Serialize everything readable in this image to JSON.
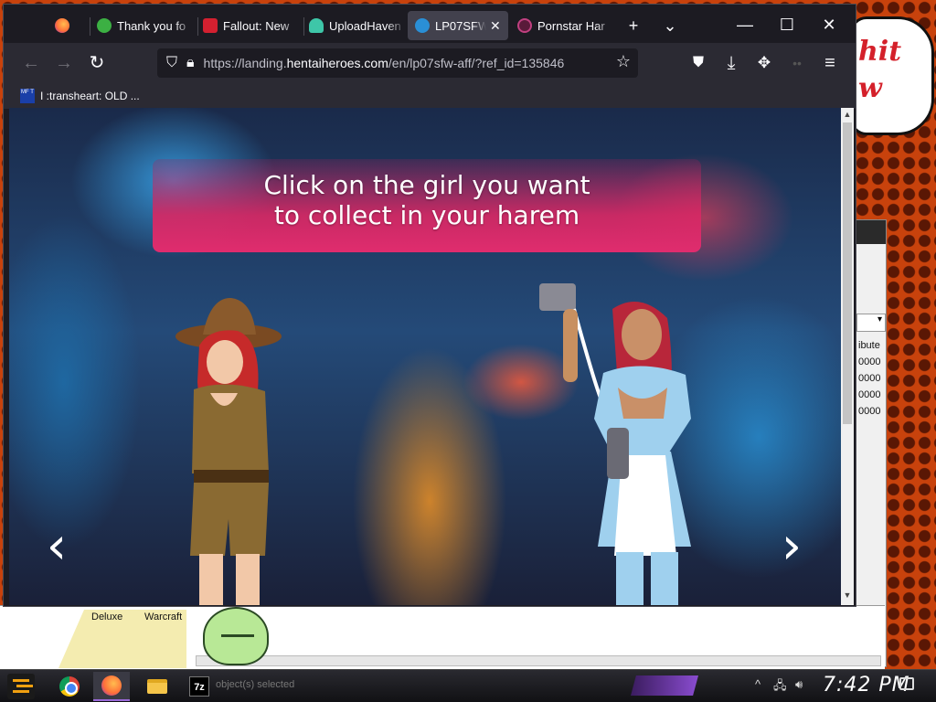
{
  "browser": {
    "tabs": [
      {
        "title": "",
        "icon": "firefox-icon",
        "active": false
      },
      {
        "title": "Thank you fo",
        "icon": "green-site-icon",
        "active": false
      },
      {
        "title": "Fallout: New",
        "icon": "red-site-icon",
        "active": false
      },
      {
        "title": "UploadHaven",
        "icon": "cloud-icon",
        "active": false
      },
      {
        "title": "LP07SFW",
        "icon": "globe-icon",
        "active": true
      },
      {
        "title": "Pornstar Har",
        "icon": "purple-site-icon",
        "active": false
      }
    ],
    "new_tab": "+",
    "tab_list": "⌄",
    "window_controls": {
      "minimize": "—",
      "maximize": "☐",
      "close": "✕"
    },
    "url_prefix": "https://landing.",
    "url_domain": "hentaiheroes.com",
    "url_path": "/en/lp07sfw-aff/?ref_id=135846",
    "bookmark_label": "I :transheart: OLD ...",
    "bookmark_icon_text": "MF T"
  },
  "page": {
    "banner_line1": "Click on the girl you want",
    "banner_line2": "to collect in your harem",
    "prev_arrow": "‹",
    "next_arrow": "›"
  },
  "desktop": {
    "bubble_line1": "hit",
    "bubble_line2": "w",
    "bg_window": {
      "header": "ibute",
      "rows": [
        "0000",
        "0000",
        "0000",
        "0000"
      ]
    },
    "explorer_labels": [
      "Deluxe",
      "Warcraft"
    ],
    "explorer_status": "object(s) selected"
  },
  "taskbar": {
    "sevenzip_label": "7z",
    "clock": "7:42 PM",
    "tray_chevron": "^"
  },
  "colors": {
    "accent_pink": "#e02c6e",
    "browser_dark": "#1c1b22",
    "firefox_toolbar": "#2b2a33",
    "desktop_orange": "#c8420c"
  }
}
